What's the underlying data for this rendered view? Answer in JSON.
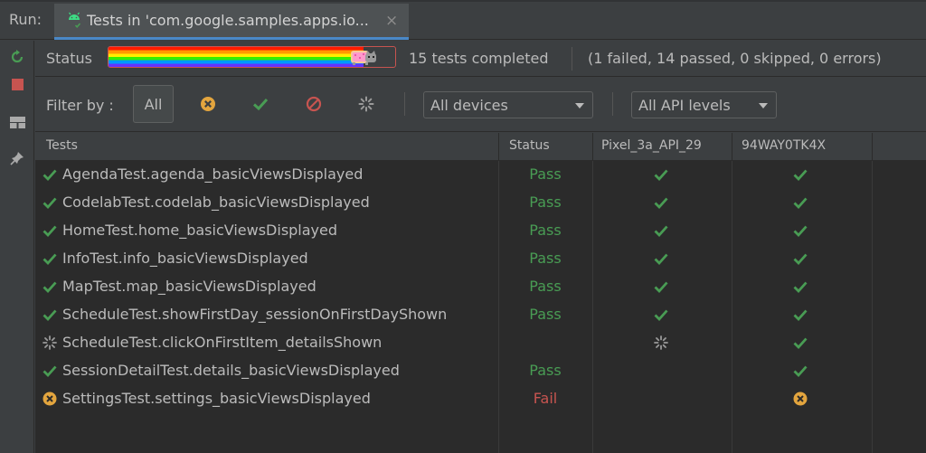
{
  "run_bar": {
    "label": "Run:",
    "tab_title": "Tests in 'com.google.samples.apps.io...",
    "tab_icon": "android-icon",
    "close_icon": "×"
  },
  "toolbar": {
    "buttons": [
      "rerun-icon",
      "stop-icon",
      "layout-icon",
      "pin-icon"
    ]
  },
  "status": {
    "label": "Status",
    "progress_fraction": 1.0,
    "completed_text": "15 tests completed",
    "summary_text": "(1 failed, 14 passed, 0 skipped, 0 errors)"
  },
  "filter": {
    "label": "Filter by :",
    "all_label": "All",
    "filter_icons": [
      "failed-icon",
      "passed-icon",
      "ignored-icon",
      "in-progress-icon"
    ],
    "devices_select": "All devices",
    "api_select": "All API levels"
  },
  "table": {
    "headers": {
      "tests": "Tests",
      "status": "Status",
      "device1": "Pixel_3a_API_29",
      "device2": "94WAY0TK4X"
    },
    "rows": [
      {
        "name": "AgendaTest.agenda_basicViewsDisplayed",
        "state": "pass",
        "status": "Pass",
        "device1": "pass",
        "device2": "pass"
      },
      {
        "name": "CodelabTest.codelab_basicViewsDisplayed",
        "state": "pass",
        "status": "Pass",
        "device1": "pass",
        "device2": "pass"
      },
      {
        "name": "HomeTest.home_basicViewsDisplayed",
        "state": "pass",
        "status": "Pass",
        "device1": "pass",
        "device2": "pass"
      },
      {
        "name": "InfoTest.info_basicViewsDisplayed",
        "state": "pass",
        "status": "Pass",
        "device1": "pass",
        "device2": "pass"
      },
      {
        "name": "MapTest.map_basicViewsDisplayed",
        "state": "pass",
        "status": "Pass",
        "device1": "pass",
        "device2": "pass"
      },
      {
        "name": "ScheduleTest.showFirstDay_sessionOnFirstDayShown",
        "state": "pass",
        "status": "Pass",
        "device1": "pass",
        "device2": "pass"
      },
      {
        "name": "ScheduleTest.clickOnFirstItem_detailsShown",
        "state": "running",
        "status": "",
        "device1": "running",
        "device2": "pass"
      },
      {
        "name": "SessionDetailTest.details_basicViewsDisplayed",
        "state": "pass",
        "status": "Pass",
        "device1": "",
        "device2": "pass"
      },
      {
        "name": "SettingsTest.settings_basicViewsDisplayed",
        "state": "fail",
        "status": "Fail",
        "device1": "",
        "device2": "fail"
      }
    ]
  },
  "colors": {
    "pass": "#499c54",
    "fail": "#c75450",
    "fail_icon": "#e3a53e",
    "accent": "#4a88c7"
  }
}
